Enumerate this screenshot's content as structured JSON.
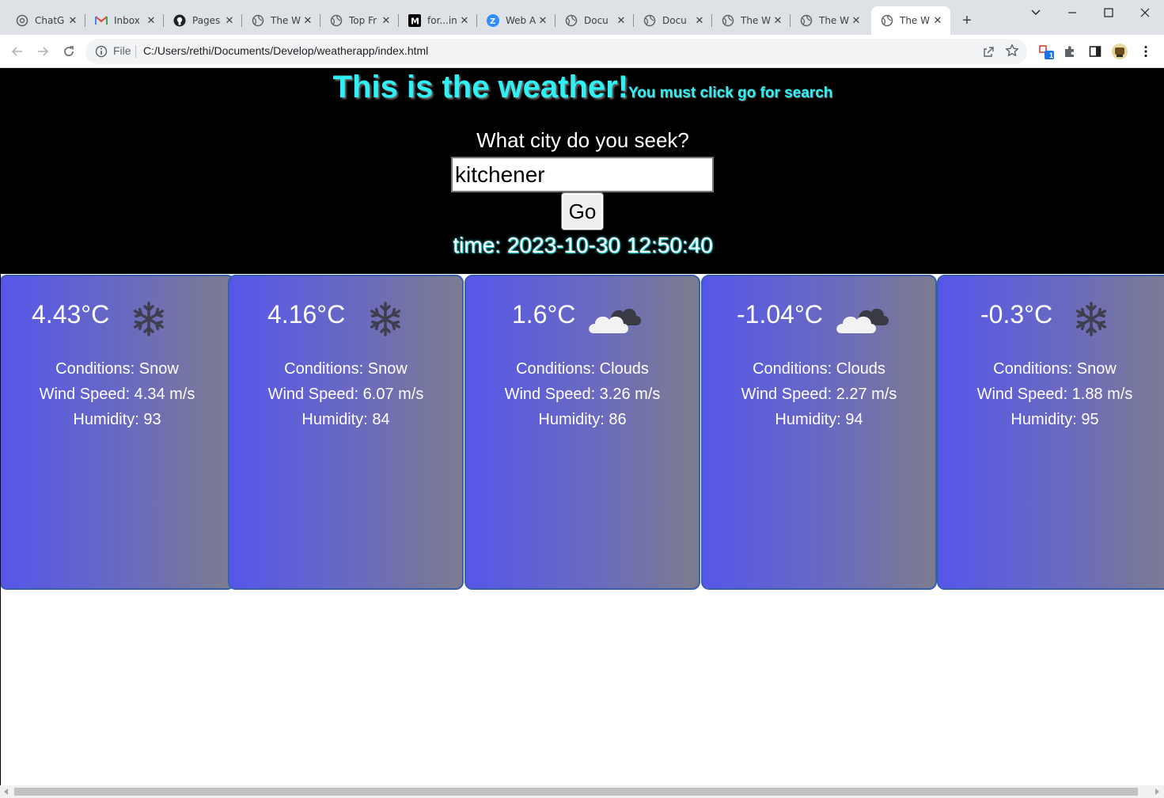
{
  "browser": {
    "tabs": [
      {
        "title": "ChatG",
        "icon": "chatgpt-icon"
      },
      {
        "title": "Inbox",
        "icon": "gmail-icon"
      },
      {
        "title": "Pages",
        "icon": "github-icon"
      },
      {
        "title": "The W",
        "icon": "globe-icon"
      },
      {
        "title": "Top Fr",
        "icon": "globe-icon"
      },
      {
        "title": "for...in",
        "icon": "medium-icon"
      },
      {
        "title": "Web A",
        "icon": "zoom-icon"
      },
      {
        "title": "Docu",
        "icon": "globe-icon"
      },
      {
        "title": "Docu",
        "icon": "globe-icon"
      },
      {
        "title": "The W",
        "icon": "globe-icon"
      },
      {
        "title": "The W",
        "icon": "globe-icon"
      },
      {
        "title": "The W",
        "icon": "globe-icon",
        "active": true
      }
    ],
    "address": {
      "scheme_label": "File",
      "url": "C:/Users/rethi/Documents/Develop/weatherapp/index.html"
    },
    "extension_badge": "1"
  },
  "page": {
    "title": "This is the weather!",
    "subtitle": "You must click go for search",
    "prompt": "What city do you seek?",
    "city_value": "kitchener",
    "go_label": "Go",
    "time_text": "time: 2023-10-30 12:50:40"
  },
  "forecast": [
    {
      "temp": "4.43°C",
      "icon": "snowflake-icon",
      "conditions": "Conditions: Snow",
      "wind": "Wind Speed: 4.34 m/s",
      "humidity": "Humidity: 93"
    },
    {
      "temp": "4.16°C",
      "icon": "snowflake-icon",
      "conditions": "Conditions: Snow",
      "wind": "Wind Speed: 6.07 m/s",
      "humidity": "Humidity: 84"
    },
    {
      "temp": "1.6°C",
      "icon": "cloud-icon",
      "conditions": "Conditions: Clouds",
      "wind": "Wind Speed: 3.26 m/s",
      "humidity": "Humidity: 86"
    },
    {
      "temp": "-1.04°C",
      "icon": "cloud-icon",
      "conditions": "Conditions: Clouds",
      "wind": "Wind Speed: 2.27 m/s",
      "humidity": "Humidity: 94"
    },
    {
      "temp": "-0.3°C",
      "icon": "snowflake-icon",
      "conditions": "Conditions: Snow",
      "wind": "Wind Speed: 1.88 m/s",
      "humidity": "Humidity: 95"
    }
  ],
  "colors": {
    "heading": "#2ff0f5",
    "hero_bg": "#000000",
    "card_gradient_start": "#5656ea",
    "card_gradient_end": "#7c7c8e",
    "card_border": "#3a5fb0"
  }
}
